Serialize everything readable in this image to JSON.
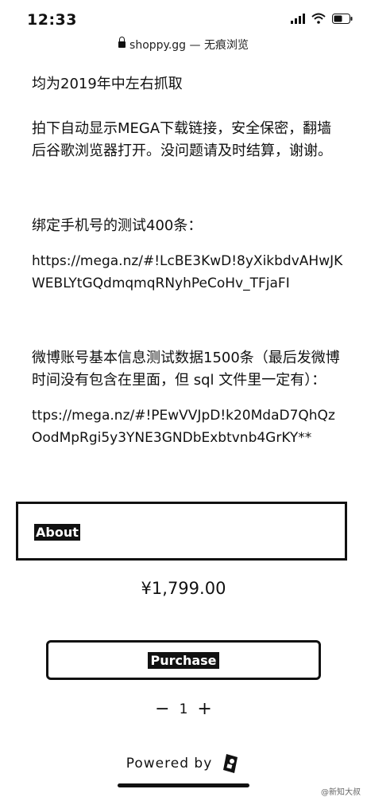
{
  "status_bar": {
    "time": "12:33"
  },
  "browser": {
    "url": "shoppy.gg — 无痕浏览"
  },
  "content": {
    "line1": "均为2019年中左右抓取",
    "line2": "拍下自动显示MEGA下载链接，安全保密，翻墙后谷歌浏览器打开。没问题请及时结算，谢谢。",
    "section1_title": "绑定手机号的测试400条：",
    "section1_url": "https://mega.nz/#!LcBE3KwD!8yXikbdvAHwJKWEBLYtGQdmqmqRNyhPeCoHv_TFjaFI",
    "section2_title": "微博账号基本信息测试数据1500条（最后发微博时间没有包含在里面，但 sql 文件里一定有）：",
    "section2_url": "ttps://mega.nz/#!PEwVVJpD!k20MdaD7QhQzOodMpRgi5y3YNE3GNDbExbtvnb4GrKY**"
  },
  "about": {
    "label": "About"
  },
  "product": {
    "price": "¥1,799.00"
  },
  "purchase": {
    "label": "Purchase"
  },
  "quantity": {
    "minus": "−",
    "value": "1",
    "plus": "+"
  },
  "footer": {
    "powered_by": "Powered by",
    "watermark": "@新知大叔"
  }
}
